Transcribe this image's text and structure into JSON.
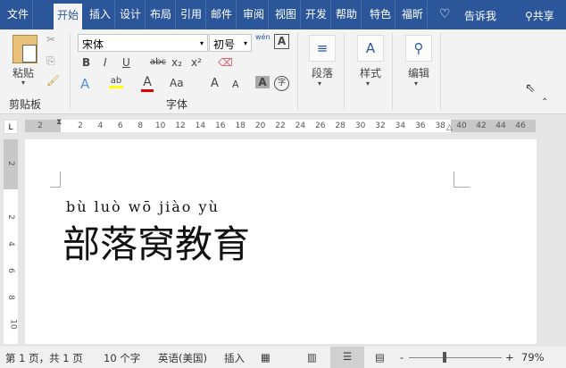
{
  "tabs": [
    "文件",
    "开始",
    "插入",
    "设计",
    "布局",
    "引用",
    "邮件",
    "审阅",
    "视图",
    "开发",
    "帮助",
    "特色",
    "福昕"
  ],
  "tell_me": "告诉我",
  "share": "共享",
  "clipboard": {
    "paste": "粘贴",
    "group": "剪贴板"
  },
  "font": {
    "name": "宋体",
    "size": "初号",
    "group": "字体",
    "bold": "B",
    "italic": "I",
    "underline": "U",
    "strike": "abc",
    "sub": "x₂",
    "sup": "x²",
    "effects": "A",
    "color": "A",
    "case": "Aa",
    "grow": "A",
    "shrink": "A",
    "shade": "A",
    "enclose": "字",
    "phonetic": "wén"
  },
  "paragraph": "段落",
  "styles": "样式",
  "editing": "编辑",
  "colors": {
    "accent": "#2b579a",
    "highlight": "#ffff00",
    "font_color": "#e00000"
  },
  "ruler": {
    "corner": "L",
    "left": [
      "2"
    ],
    "main": [
      "2",
      "4",
      "6",
      "8",
      "10",
      "12",
      "14",
      "16",
      "18",
      "20",
      "22",
      "24",
      "26",
      "28",
      "30",
      "32",
      "34",
      "36",
      "38"
    ],
    "right": [
      "40",
      "42",
      "44",
      "46"
    ],
    "vertical": [
      "2",
      "2",
      "4",
      "6",
      "8",
      "10"
    ]
  },
  "document": {
    "pinyin": "bù luò wō jiào yù",
    "text": "部落窝教育"
  },
  "status": {
    "page": "第 1 页，共 1 页",
    "words": "10 个字",
    "lang": "英语(美国)",
    "mode": "插入",
    "zoom": "79%",
    "zoom_level": 0.79
  }
}
